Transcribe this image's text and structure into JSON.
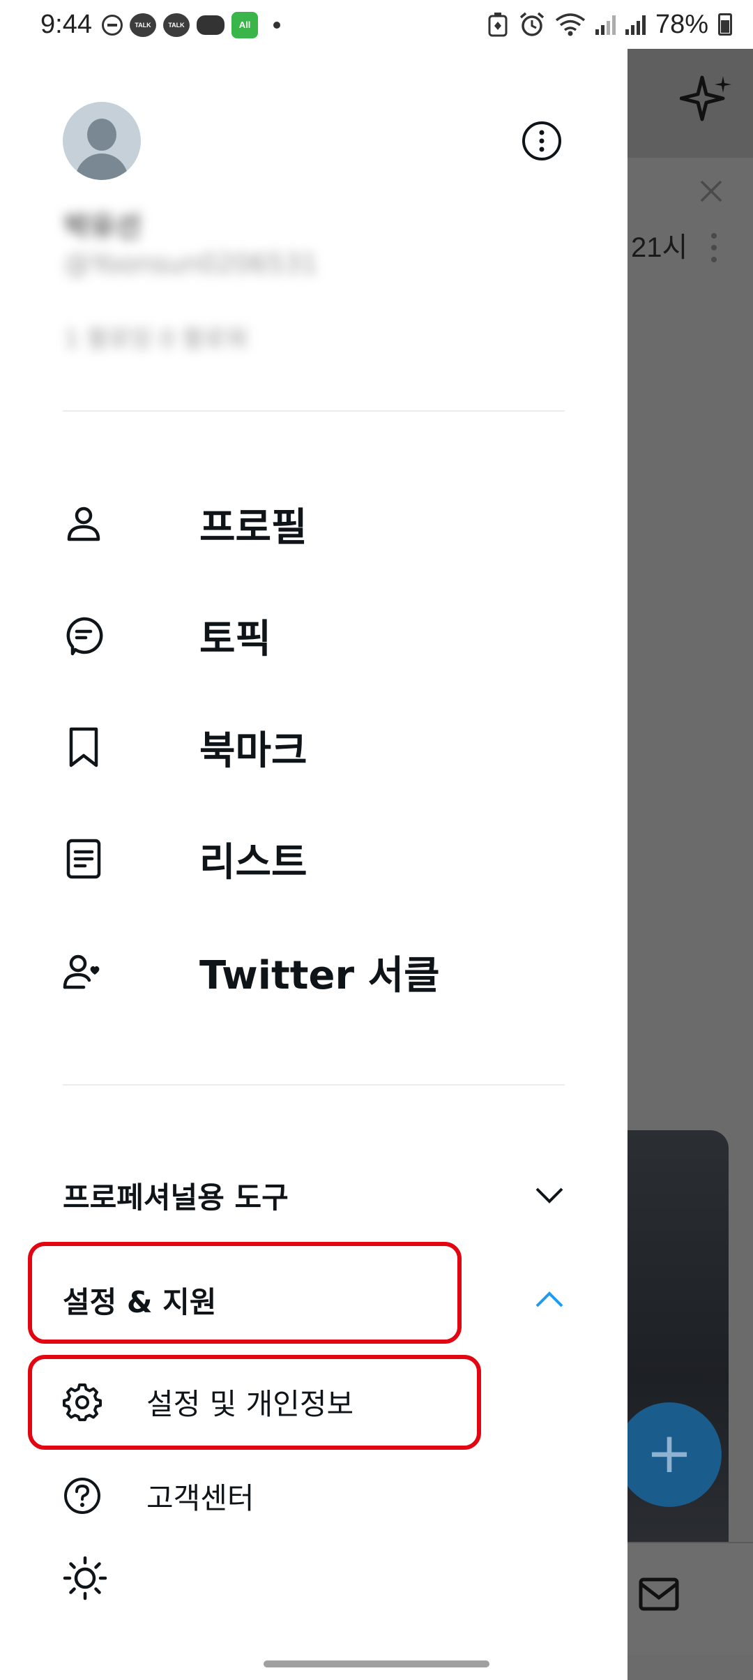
{
  "status_bar": {
    "time": "9:44",
    "notif_talk_1": "TALK",
    "notif_talk_2": "TALK",
    "notif_all": "All",
    "battery_percent": "78%"
  },
  "background_app": {
    "timestamp": "21시",
    "fab_symbol": "+"
  },
  "profile": {
    "display_name": "박유선",
    "handle": "@Yoonsun0206531",
    "follow_stats": "1 팔로잉  0 팔로워"
  },
  "menu": {
    "items": [
      {
        "label": "프로필",
        "icon": "person-icon"
      },
      {
        "label": "토픽",
        "icon": "topic-bubble-icon"
      },
      {
        "label": "북마크",
        "icon": "bookmark-icon"
      },
      {
        "label": "리스트",
        "icon": "list-document-icon"
      },
      {
        "label": "Twitter 서클",
        "icon": "circle-person-heart-icon"
      }
    ]
  },
  "sections": {
    "professional_tools": "프로페셔널용 도구",
    "settings_support": "설정 & 지원"
  },
  "settings_submenu": {
    "settings_privacy": "설정 및 개인정보",
    "help_center": "고객센터"
  },
  "colors": {
    "accent": "#1d9bf0",
    "highlight": "#e20612",
    "text": "#0f1419",
    "overlay": "#6b6b6b"
  }
}
